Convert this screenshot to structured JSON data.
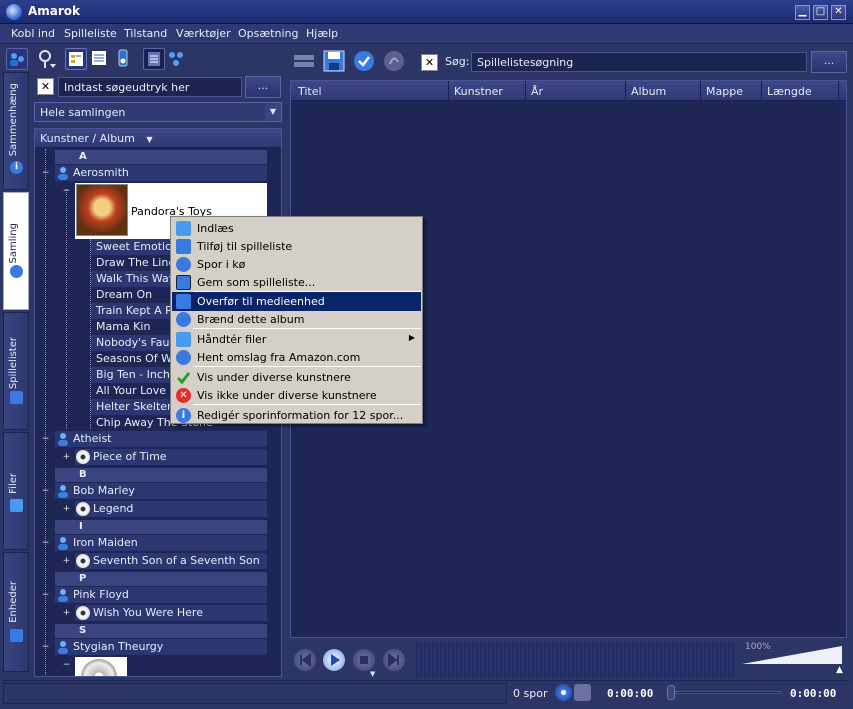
{
  "window": {
    "title": "Amarok",
    "minimize": "▁",
    "maximize": "□",
    "close": "✕"
  },
  "menu": [
    "Kobl ind",
    "Spilleliste",
    "Tilstand",
    "Værktøjer",
    "Opsætning",
    "Hjælp"
  ],
  "left_tabs": [
    {
      "label": "Sammenhæng",
      "icon": "info-icon"
    },
    {
      "label": "Samling",
      "icon": "collection-icon",
      "active": true
    },
    {
      "label": "Spillelister",
      "icon": "playlist-icon"
    },
    {
      "label": "Filer",
      "icon": "folder-icon"
    },
    {
      "label": "Enheder",
      "icon": "device-icon"
    }
  ],
  "collection": {
    "search_placeholder": "Indtast søgeudtryk her",
    "more": "...",
    "filter": "Hele samlingen",
    "header": "Kunstner / Album",
    "tree": {
      "letter_a": "A",
      "aerosmith": "Aerosmith",
      "pandoras": "Pandora's Toys",
      "tracks": [
        "Sweet Emotion",
        "Draw The Line",
        "Walk This Way",
        "Dream On",
        "Train Kept A Ro",
        "Mama Kin",
        "Nobody's Fault",
        "Seasons Of Wi",
        "Big Ten - Inch R",
        "All Your Love",
        "Helter Skelter",
        "Chip Away The Stone"
      ],
      "atheist": "Atheist",
      "piece_of_time": "Piece of Time",
      "letter_b": "B",
      "bob_marley": "Bob Marley",
      "legend": "Legend",
      "letter_i": "I",
      "iron_maiden": "Iron Maiden",
      "seventh_son": "Seventh Son of a Seventh Son",
      "letter_p": "P",
      "pink_floyd": "Pink Floyd",
      "wish": "Wish You Were Here",
      "letter_s": "S",
      "stygian": "Stygian Theurgy"
    }
  },
  "playlist": {
    "search_label": "Søg:",
    "search_value": "Spillelistesøgning",
    "more": "...",
    "columns": [
      "Titel",
      "Kunstner",
      "År",
      "Album",
      "Mappe",
      "Længde"
    ]
  },
  "context_menu": [
    {
      "label": "Indlæs",
      "icon": "folder-icon"
    },
    {
      "label": "Tilføj til spilleliste",
      "icon": "playlist-add-icon"
    },
    {
      "label": "Spor i kø",
      "icon": "queue-icon"
    },
    {
      "label": "Gem som spilleliste...",
      "icon": "save-icon"
    },
    {
      "label": "Overfør til medieenhed",
      "icon": "device-icon",
      "highlight": true
    },
    {
      "label": "Brænd dette album",
      "icon": "burn-icon"
    },
    {
      "label": "Håndtér filer",
      "icon": "folder-icon",
      "submenu": true
    },
    {
      "label": "Hent omslag fra Amazon.com",
      "icon": "amazon-icon"
    },
    {
      "label": "Vis under diverse kunstnere",
      "icon": "check-icon"
    },
    {
      "label": "Vis ikke under diverse kunstnere",
      "icon": "x-icon"
    },
    {
      "label": "Redigér sporinformation for 12 spor...",
      "icon": "info-icon"
    }
  ],
  "player": {
    "volume": "100%",
    "volume_level": 1.0
  },
  "status": {
    "tracks": "0 spor",
    "elapsed": "0:00:00",
    "remaining": "0:00:00"
  }
}
